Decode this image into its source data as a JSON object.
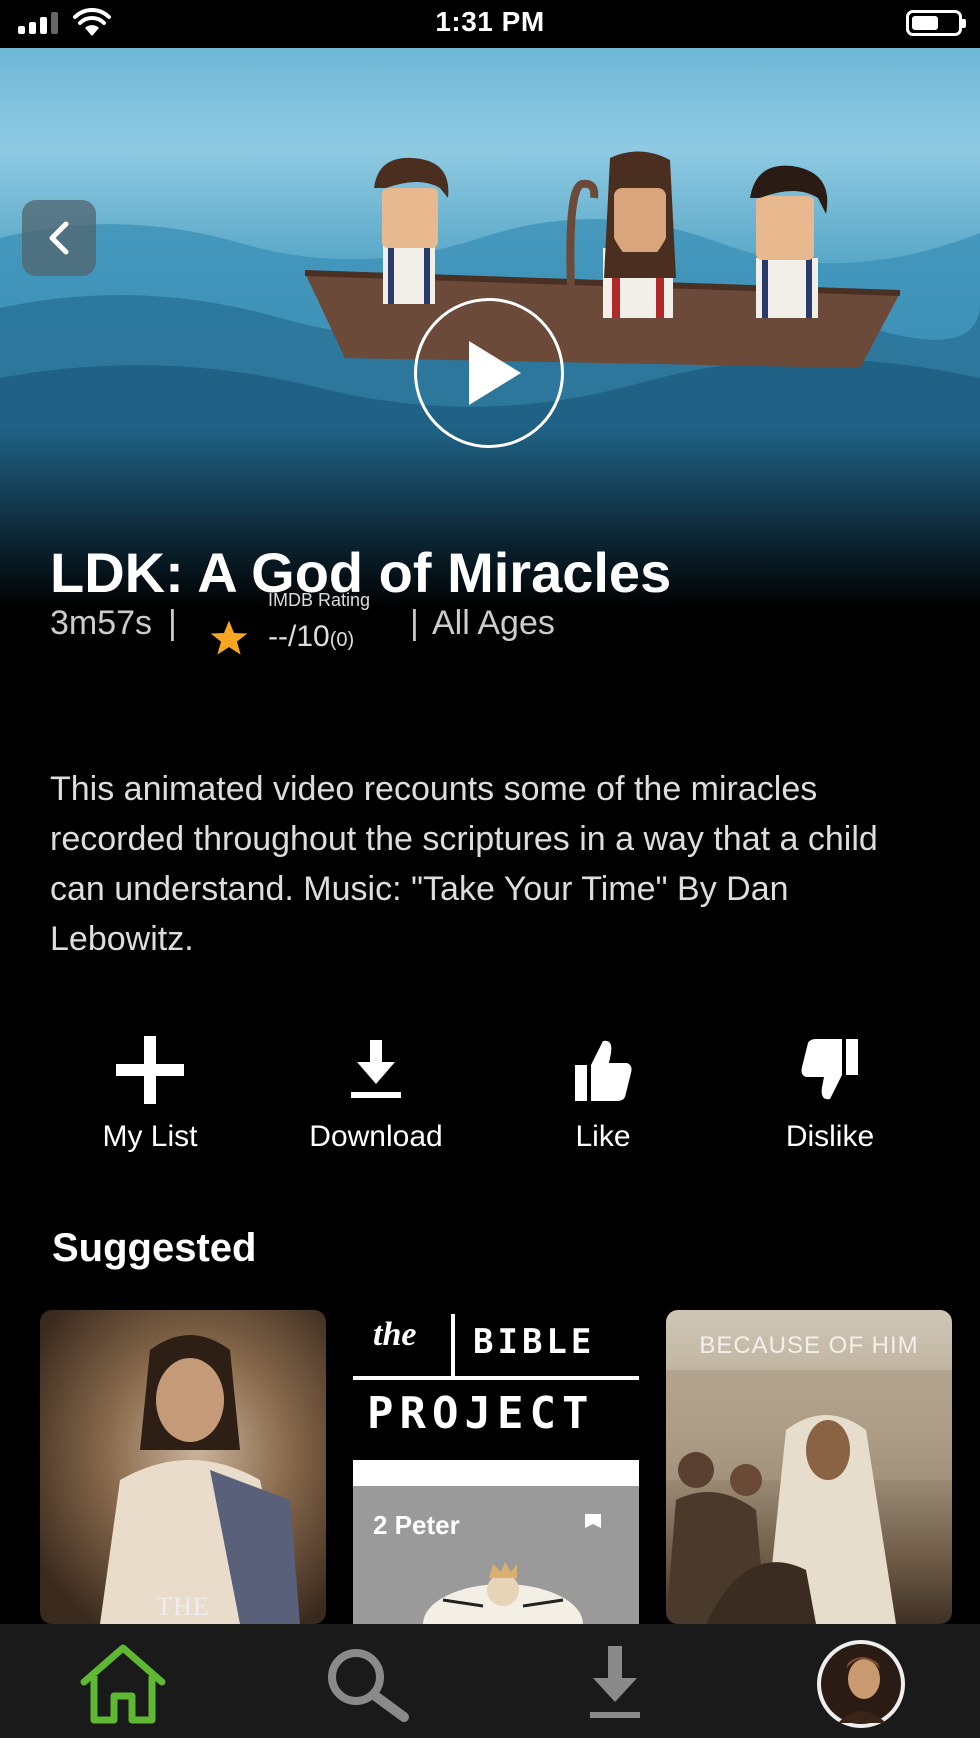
{
  "status_bar": {
    "time": "1:31 PM"
  },
  "video": {
    "title": "LDK: A God of Miracles",
    "duration": "3m57s",
    "imdb_label": "IMDB Rating",
    "imdb_rating": "--/10",
    "imdb_count": "(0)",
    "age_rating": "All Ages",
    "separator": "|",
    "description": "This animated video recounts some of the miracles recorded throughout the scriptures in a way that a child can understand. Music: \"Take Your Time\" By Dan Lebowitz."
  },
  "actions": [
    {
      "label": "My List",
      "icon": "plus-icon"
    },
    {
      "label": "Download",
      "icon": "download-icon"
    },
    {
      "label": "Like",
      "icon": "thumbs-up-icon"
    },
    {
      "label": "Dislike",
      "icon": "thumbs-down-icon"
    }
  ],
  "suggested": {
    "heading": "Suggested",
    "items": [
      {
        "caption": "THE"
      },
      {
        "brand_the": "the",
        "brand_bible": "BIBLE",
        "brand_project": "PROJECT",
        "caption": "2 Peter"
      },
      {
        "caption": "BECAUSE OF HIM"
      }
    ]
  },
  "bottom_nav": [
    "home-icon",
    "search-icon",
    "download-icon",
    "profile-avatar"
  ],
  "colors": {
    "accent": "#5fb832",
    "star": "#f5a623",
    "background": "#000000"
  }
}
